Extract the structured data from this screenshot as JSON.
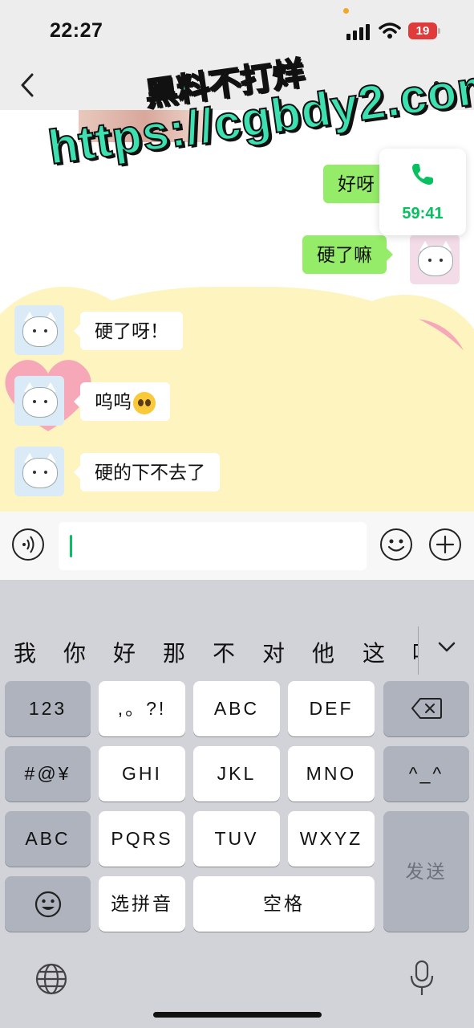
{
  "status_bar": {
    "time": "22:27",
    "battery": "19"
  },
  "nav": {
    "back_icon": "chevron-left-icon",
    "more_icon": "ellipsis-icon"
  },
  "watermark": {
    "line1": "黑料不打烊",
    "line2": "https://cgbdy2.com"
  },
  "messages": [
    {
      "side": "right",
      "text": "好呀"
    },
    {
      "side": "right",
      "text": "硬了嘛"
    },
    {
      "side": "left",
      "text": "硬了呀！"
    },
    {
      "side": "left",
      "text": "呜呜"
    },
    {
      "side": "left",
      "text": "硬的下不去了"
    }
  ],
  "call": {
    "duration": "59:41",
    "icon": "phone-icon"
  },
  "input": {
    "value": ""
  },
  "keyboard": {
    "candidates": [
      "我",
      "你",
      "好",
      "那",
      "不",
      "对",
      "他",
      "这",
      "呢"
    ],
    "keys": {
      "k123": "123",
      "punct": ",。?!",
      "abc": "ABC",
      "def": "DEF",
      "symbols": "#@¥",
      "ghi": "GHI",
      "jkl": "JKL",
      "mno": "MNO",
      "kaomoji": "^_^",
      "abc_switch": "ABC",
      "pqrs": "PQRS",
      "tuv": "TUV",
      "wxyz": "WXYZ",
      "send": "发送",
      "pinyin": "选拼音",
      "space": "空格"
    }
  },
  "colors": {
    "wechat_green": "#95ec69",
    "accent": "#07c160"
  }
}
